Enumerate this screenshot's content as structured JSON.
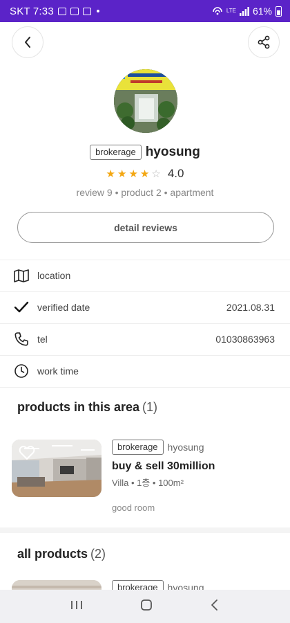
{
  "status_bar": {
    "time": "SKT 7:33",
    "network": "LTE",
    "battery": "61%"
  },
  "colors": {
    "status_bar_bg": "#5b23c8",
    "star_filled": "#f3a712",
    "star_empty": "#bbbbbb"
  },
  "profile": {
    "tag": "brokerage",
    "name": "hyosung",
    "rating": "4.0",
    "rating_value": 4,
    "rating_max": 5,
    "meta": "review 9 • product 2 • apartment",
    "detail_button_label": "detail reviews"
  },
  "info": [
    {
      "icon": "map-icon",
      "label": "location",
      "value": ""
    },
    {
      "icon": "check-icon",
      "label": "verified date",
      "value": "2021.08.31"
    },
    {
      "icon": "phone-icon",
      "label": "tel",
      "value": "01030863963"
    },
    {
      "icon": "clock-icon",
      "label": "work time",
      "value": ""
    }
  ],
  "sections": {
    "area_products": {
      "title": "products in this area",
      "count": "(1)"
    },
    "all_products": {
      "title": "all products",
      "count": "(2)"
    }
  },
  "products": [
    {
      "tag": "brokerage",
      "agent": "hyosung",
      "title": "buy & sell 30million",
      "sub": "Villa • 1층 • 100m²",
      "desc": "good room"
    },
    {
      "tag": "brokerage",
      "agent": "hyosung"
    }
  ]
}
